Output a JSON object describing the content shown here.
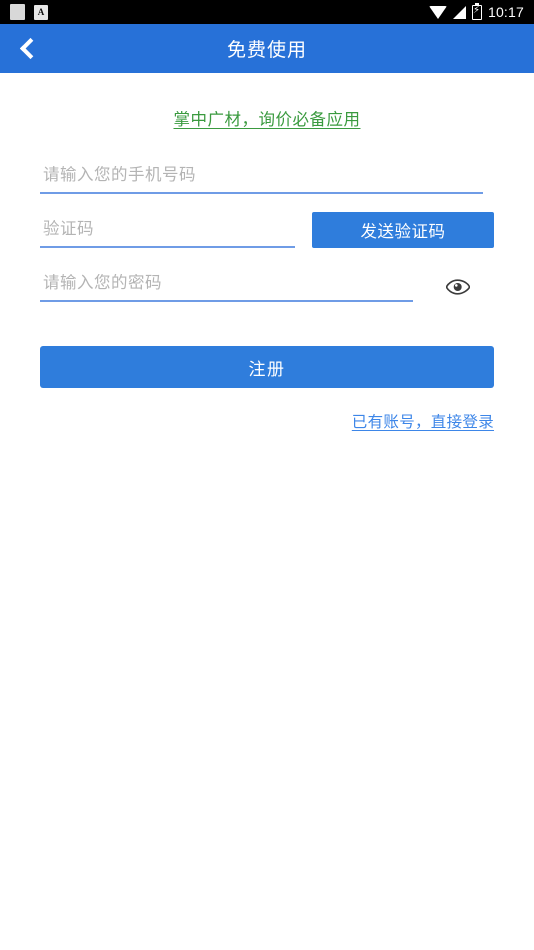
{
  "status_bar": {
    "time": "10:17",
    "icons": [
      "notification-square-icon",
      "app-badge-icon",
      "wifi-icon",
      "signal-icon",
      "battery-charging-icon"
    ],
    "badge_letter": "A",
    "background": "#000000"
  },
  "app_bar": {
    "title": "免费使用",
    "back_icon": "chevron-left-icon",
    "background": "#2771d8"
  },
  "content": {
    "slogan": "掌中广材，询价必备应用",
    "slogan_color": "#3a9a3f",
    "form": {
      "phone": {
        "placeholder": "请输入您的手机号码",
        "value": ""
      },
      "code": {
        "placeholder": "验证码",
        "value": ""
      },
      "send_code_label": "发送验证码",
      "password": {
        "placeholder": "请输入您的密码",
        "value": ""
      },
      "password_toggle_icon": "eye-icon"
    },
    "register_label": "注册",
    "login_link": "已有账号，直接登录",
    "accent_color": "#2f7ddc",
    "underline_color": "#6f9ce6",
    "placeholder_color": "#b4b4b4",
    "link_color": "#3d86e8"
  }
}
